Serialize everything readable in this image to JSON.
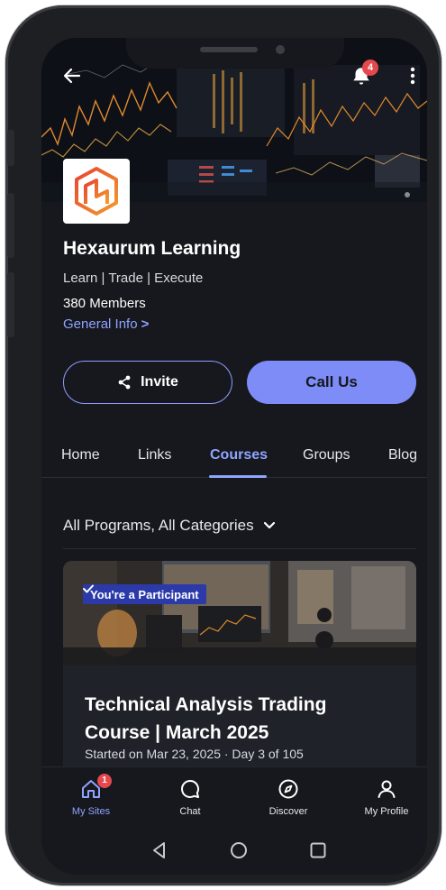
{
  "header": {
    "notification_count": "4"
  },
  "site": {
    "title": "Hexaurum Learning",
    "tagline": "Learn | Trade | Execute",
    "members": "380 Members",
    "general_info": "General Info",
    "general_info_chevron": ">"
  },
  "actions": {
    "invite_label": "Invite",
    "call_label": "Call Us"
  },
  "tabs": [
    {
      "label": "Home",
      "active": false
    },
    {
      "label": "Links",
      "active": false
    },
    {
      "label": "Courses",
      "active": true
    },
    {
      "label": "Groups",
      "active": false
    },
    {
      "label": "Blog",
      "active": false
    }
  ],
  "filter": {
    "label": "All Programs, All Categories"
  },
  "course": {
    "badge": "You're a Participant",
    "title": "Technical Analysis Trading Course | March 2025",
    "meta": "Started on Mar 23, 2025 · Day 3 of 105"
  },
  "bottom_nav": [
    {
      "label": "My Sites",
      "icon": "home-icon",
      "badge": "1",
      "active": true
    },
    {
      "label": "Chat",
      "icon": "chat-icon",
      "active": false
    },
    {
      "label": "Discover",
      "icon": "compass-icon",
      "active": false
    },
    {
      "label": "My Profile",
      "icon": "profile-icon",
      "active": false
    }
  ],
  "colors": {
    "accent": "#8fa4ff",
    "button_fill": "#7d8cf6",
    "background": "#16181d",
    "badge_red": "#e5484d",
    "participant_badge": "#2b3aa8"
  }
}
